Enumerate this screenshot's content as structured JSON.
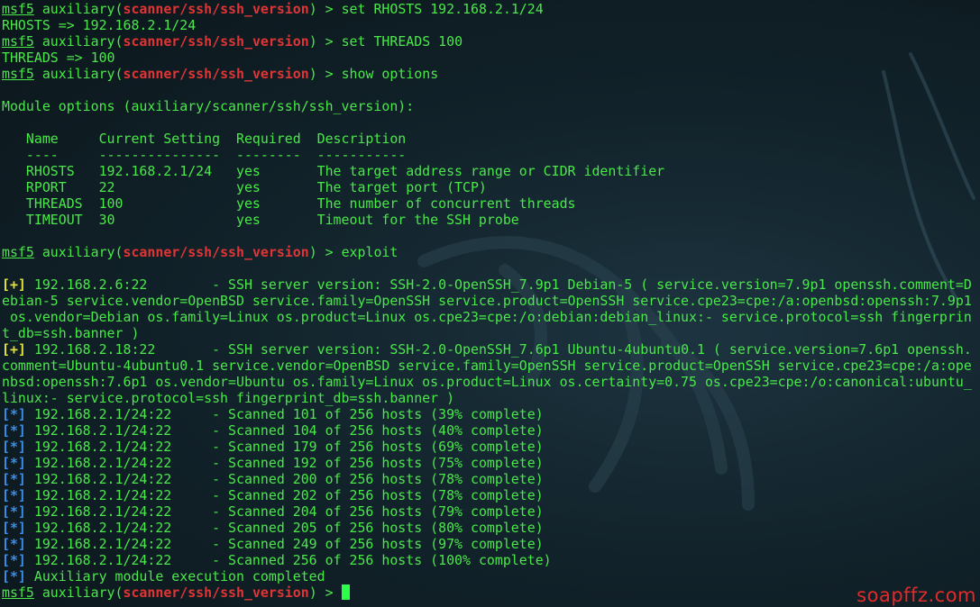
{
  "prompt": {
    "name": "msf5",
    "pre": " auxiliary(",
    "module": "scanner/ssh/ssh_version",
    "post": ") > "
  },
  "commands": {
    "set_rhosts": "set RHOSTS 192.168.2.1/24",
    "rhosts_out": "RHOSTS => 192.168.2.1/24",
    "set_threads": "set THREADS 100",
    "threads_out": "THREADS => 100",
    "show": "show options",
    "exploit": "exploit"
  },
  "options": {
    "heading": "Module options (auxiliary/scanner/ssh/ssh_version):",
    "header_row": "   Name     Current Setting  Required  Description",
    "divider_row": "   ----     ---------------  --------  -----------",
    "rows": [
      "   RHOSTS   192.168.2.1/24   yes       The target address range or CIDR identifier",
      "   RPORT    22               yes       The target port (TCP)",
      "   THREADS  100              yes       The number of concurrent threads",
      "   TIMEOUT  30               yes       Timeout for the SSH probe"
    ]
  },
  "results": {
    "plus_marker": "[+]",
    "star_marker": "[*]",
    "host1": {
      "first": " 192.168.2.6:22        - SSH server version: SSH-2.0-OpenSSH_7.9p1 Debian-5 ( service.version=7.9p1 openssh.comment=D",
      "cont": [
        "ebian-5 service.vendor=OpenBSD service.family=OpenSSH service.product=OpenSSH service.cpe23=cpe:/a:openbsd:openssh:7.9p1",
        " os.vendor=Debian os.family=Linux os.product=Linux os.cpe23=cpe:/o:debian:debian_linux:- service.protocol=ssh fingerprin",
        "t_db=ssh.banner )"
      ]
    },
    "host2": {
      "first": " 192.168.2.18:22       - SSH server version: SSH-2.0-OpenSSH_7.6p1 Ubuntu-4ubuntu0.1 ( service.version=7.6p1 openssh.",
      "cont": [
        "comment=Ubuntu-4ubuntu0.1 service.vendor=OpenBSD service.family=OpenSSH service.product=OpenSSH service.cpe23=cpe:/a:ope",
        "nbsd:openssh:7.6p1 os.vendor=Ubuntu os.family=Linux os.product=Linux os.certainty=0.75 os.cpe23=cpe:/o:canonical:ubuntu_",
        "linux:- service.protocol=ssh fingerprint_db=ssh.banner )"
      ]
    },
    "progress": [
      " 192.168.2.1/24:22     - Scanned 101 of 256 hosts (39% complete)",
      " 192.168.2.1/24:22     - Scanned 104 of 256 hosts (40% complete)",
      " 192.168.2.1/24:22     - Scanned 179 of 256 hosts (69% complete)",
      " 192.168.2.1/24:22     - Scanned 192 of 256 hosts (75% complete)",
      " 192.168.2.1/24:22     - Scanned 200 of 256 hosts (78% complete)",
      " 192.168.2.1/24:22     - Scanned 202 of 256 hosts (78% complete)",
      " 192.168.2.1/24:22     - Scanned 204 of 256 hosts (79% complete)",
      " 192.168.2.1/24:22     - Scanned 205 of 256 hosts (80% complete)",
      " 192.168.2.1/24:22     - Scanned 249 of 256 hosts (97% complete)",
      " 192.168.2.1/24:22     - Scanned 256 of 256 hosts (100% complete)"
    ],
    "completed": " Auxiliary module execution completed"
  },
  "watermark": "soapffz.com",
  "colors": {
    "text": "#4ae84a",
    "module": "#e13535",
    "info_marker": "#3b8eea",
    "success_marker": "#e3e33a",
    "cursor": "#2aff4a",
    "background": "#0e1c22"
  },
  "icons": [
    "kali-dragon-icon"
  ]
}
